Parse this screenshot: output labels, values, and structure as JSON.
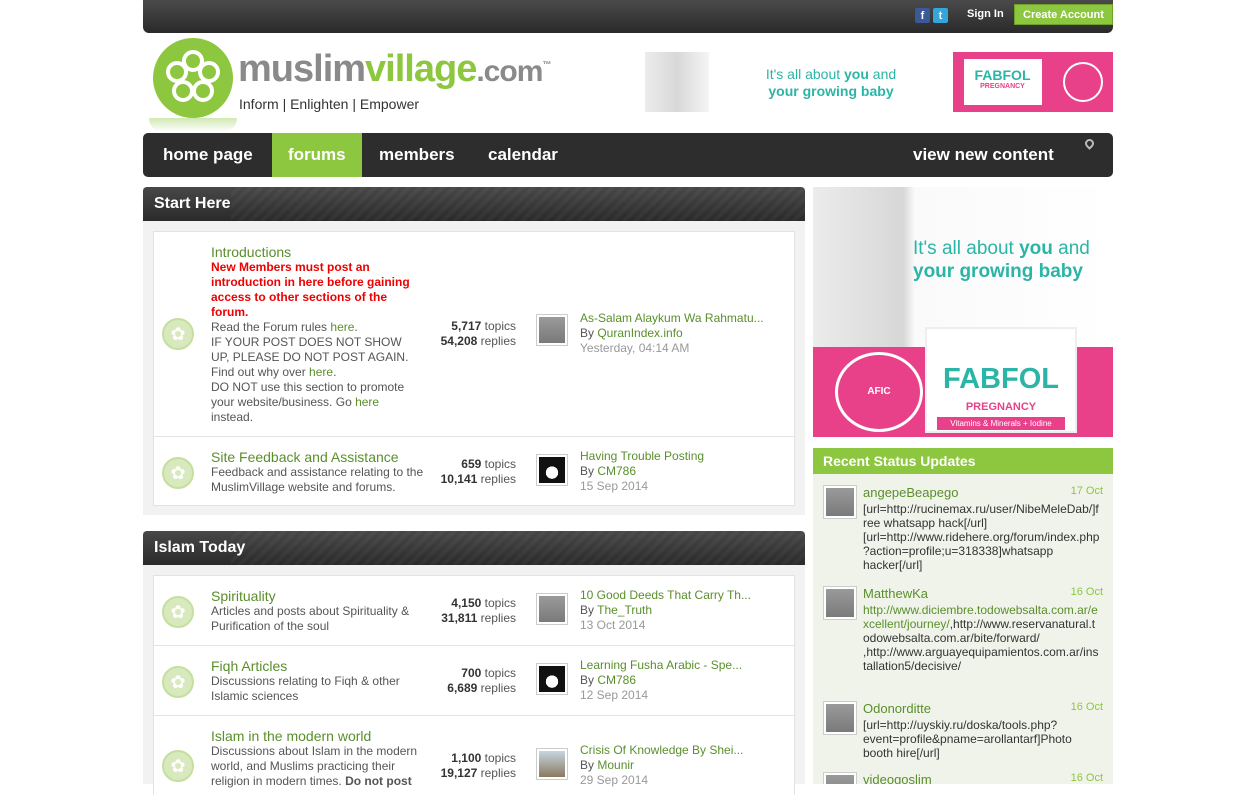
{
  "topbar": {
    "facebook_icon": "f",
    "twitter_icon": "t",
    "sign_in": "Sign In",
    "create_account": "Create Account"
  },
  "header": {
    "logo_part1": "muslim",
    "logo_part2": "village",
    "logo_part3": ".com",
    "logo_tm": "™",
    "tagline": "Inform | Enlighten | Empower",
    "banner_line1a": "It's all about ",
    "banner_line1b": "you",
    "banner_line1c": " and",
    "banner_line2": "your growing baby",
    "banner_brand": "FABFOL",
    "banner_product": "PREGNANCY"
  },
  "nav": {
    "items": [
      {
        "label": "home page"
      },
      {
        "label": "forums"
      },
      {
        "label": "members"
      },
      {
        "label": "calendar"
      }
    ],
    "view_new": "view new content"
  },
  "sections": [
    {
      "title": "Start Here",
      "forums": [
        {
          "title": "Introductions",
          "warning": "New Members must post an introduction in here before gaining access to other sections of the forum.",
          "desc1": "Read the Forum rules ",
          "desc1_link": "here",
          "desc2": "IF YOUR POST DOES NOT SHOW UP, PLEASE DO NOT POST AGAIN. Find out why over ",
          "desc2_link": "here",
          "desc3": "DO NOT use this section to promote your website/business. Go ",
          "desc3_link": "here",
          "desc3_end": " instead.",
          "topics": "5,717",
          "replies": "54,208",
          "last_title": "As-Salam Alaykum Wa Rahmatu...",
          "last_by": "QuranIndex.info",
          "last_date": "Yesterday, 04:14 AM"
        },
        {
          "title": "Site Feedback and Assistance",
          "desc": "Feedback and assistance relating to the MuslimVillage website and forums.",
          "topics": "659",
          "replies": "10,141",
          "last_title": "Having Trouble Posting",
          "last_by": "CM786",
          "last_date": "15 Sep 2014"
        }
      ]
    },
    {
      "title": "Islam Today",
      "forums": [
        {
          "title": "Spirituality",
          "desc": "Articles and posts about Spirituality & Purification of the soul",
          "topics": "4,150",
          "replies": "31,811",
          "last_title": "10 Good Deeds That Carry Th...",
          "last_by": "The_Truth",
          "last_date": "13 Oct 2014"
        },
        {
          "title": "Fiqh Articles",
          "desc": "Discussions relating to Fiqh & other Islamic sciences",
          "topics": "700",
          "replies": "6,689",
          "last_title": "Learning Fusha Arabic - Spe...",
          "last_by": "CM786",
          "last_date": "12 Sep 2014"
        },
        {
          "title": "Islam in the modern world",
          "desc": "Discussions about Islam in the modern world, and Muslims practicing their religion in modern times. ",
          "desc_bold": "Do not post",
          "topics": "1,100",
          "replies": "19,127",
          "last_title": "Crisis Of Knowledge By Shei...",
          "last_by": "Mounir",
          "last_date": "29 Sep 2014"
        }
      ]
    }
  ],
  "labels": {
    "topics": "topics",
    "replies": "replies",
    "by": "By "
  },
  "side_ad": {
    "line1a": "It's all about ",
    "line1b": "you",
    "line1c": " and",
    "line2": "your growing baby",
    "brand": "FABFOL",
    "product": "PREGNANCY",
    "vitamins": "Vitamins & Minerals + Iodine",
    "seal": "AFIC"
  },
  "status": {
    "title": "Recent Status Updates",
    "items": [
      {
        "name": "angepeBeapego",
        "date": "17 Oct",
        "text": "[url=http://rucinemax.ru/user/NibeMeleDab/]free whatsapp hack[/url] [url=http://www.ridehere.org/forum/index.php?action=profile;u=318338]whatsapp hacker[/url]"
      },
      {
        "name": "MatthewKa",
        "date": "16 Oct",
        "link": "http://www.diciembre.todowebsalta.com.ar/excellent/journey/",
        "text": ",http://www.reservanatural.todowebsalta.com.ar/bite/forward/ ,http://www.arguayequipamientos.com.ar/installation5/decisive/"
      },
      {
        "name": "Odonorditte",
        "date": "16 Oct",
        "text": "[url=http://uyskiy.ru/doska/tools.php?event=profile&pname=arollantarf]Photo booth hire[/url]"
      },
      {
        "name": "videogoslim",
        "date": "16 Oct",
        "text": ""
      }
    ]
  },
  "colors": {
    "accent": "#8dc63f",
    "link": "#5a8f2c",
    "dark": "#2d2d2d",
    "pink": "#e8418a",
    "teal": "#2bb5a6"
  }
}
